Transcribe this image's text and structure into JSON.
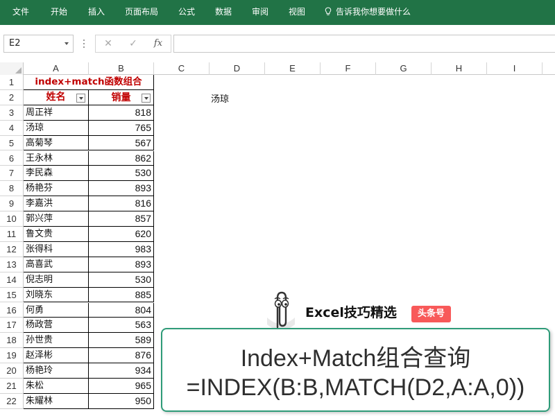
{
  "ribbon": {
    "tabs": [
      "文件",
      "开始",
      "插入",
      "页面布局",
      "公式",
      "数据",
      "审阅",
      "视图"
    ],
    "tell_me": "告诉我你想要做什么"
  },
  "formula_bar": {
    "name_box": "E2",
    "fx_label": "fx",
    "cancel_glyph": "✕",
    "enter_glyph": "✓",
    "formula": ""
  },
  "grid": {
    "columns": [
      "A",
      "B",
      "C",
      "D",
      "E",
      "F",
      "G",
      "H",
      "I"
    ],
    "row_numbers": [
      "1",
      "2",
      "3",
      "4",
      "5",
      "6",
      "7",
      "8",
      "9",
      "10",
      "11",
      "12",
      "13",
      "14",
      "15",
      "16",
      "17",
      "18",
      "19",
      "20",
      "21",
      "22"
    ],
    "title": "index+match函数组合",
    "header_name": "姓名",
    "header_sales": "销量",
    "lookup_value": "汤琼",
    "records": [
      {
        "name": "周正祥",
        "sales": "818"
      },
      {
        "name": "汤琼",
        "sales": "765"
      },
      {
        "name": "高菊琴",
        "sales": "567"
      },
      {
        "name": "王永林",
        "sales": "862"
      },
      {
        "name": "李民森",
        "sales": "530"
      },
      {
        "name": "杨艳芬",
        "sales": "893"
      },
      {
        "name": "李嘉洪",
        "sales": "816"
      },
      {
        "name": "郭兴萍",
        "sales": "857"
      },
      {
        "name": "鲁文贵",
        "sales": "620"
      },
      {
        "name": "张得科",
        "sales": "983"
      },
      {
        "name": "高喜武",
        "sales": "893"
      },
      {
        "name": "倪志明",
        "sales": "530"
      },
      {
        "name": "刘晓东",
        "sales": "885"
      },
      {
        "name": "何勇",
        "sales": "804"
      },
      {
        "name": "杨政营",
        "sales": "563"
      },
      {
        "name": "孙世贵",
        "sales": "589"
      },
      {
        "name": "赵泽彬",
        "sales": "876"
      },
      {
        "name": "杨艳玲",
        "sales": "934"
      },
      {
        "name": "朱松",
        "sales": "965"
      },
      {
        "name": "朱耀林",
        "sales": "950"
      }
    ]
  },
  "overlay": {
    "brand": "Excel技巧精选",
    "badge": "头条号",
    "caption_line1": "Index+Match组合查询",
    "caption_line2": "=INDEX(B:B,MATCH(D2,A:A,0))"
  },
  "colors": {
    "ribbon": "#217346",
    "header_text": "#c00000",
    "caption_border": "#2e9b78",
    "badge": "#f85959"
  }
}
